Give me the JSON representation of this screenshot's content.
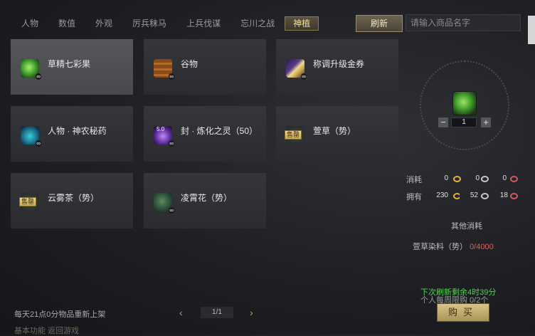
{
  "tabs": [
    {
      "label": "人物",
      "active": false
    },
    {
      "label": "数值",
      "active": false
    },
    {
      "label": "外观",
      "active": false
    },
    {
      "label": "厉兵秣马",
      "active": false
    },
    {
      "label": "上兵伐谋",
      "active": false
    },
    {
      "label": "忘川之战",
      "active": false
    },
    {
      "label": "神植",
      "active": true
    }
  ],
  "toolbar": {
    "refresh_label": "刷新",
    "search_placeholder": "请输入商品名字"
  },
  "items": [
    {
      "name": "草精七彩果",
      "icon": "fruit-icon",
      "selected": true
    },
    {
      "name": "谷物",
      "icon": "grain-barrel-icon",
      "selected": false
    },
    {
      "name": "称调升级金券",
      "icon": "gold-ticket-icon",
      "selected": false
    },
    {
      "name": "人物 · 神农秘药",
      "icon": "potion-icon",
      "selected": false
    },
    {
      "name": "封 · 炼化之灵（50）",
      "icon": "spirit-orb-icon",
      "icon_text": "5.0",
      "selected": false
    },
    {
      "name": "萱草（势）",
      "icon": "herb-icon",
      "badge": "售罄",
      "selected": false
    },
    {
      "name": "云雾茶（势）",
      "icon": "tea-icon",
      "badge": "售罄",
      "selected": false
    },
    {
      "name": "凌霄花（势）",
      "icon": "flower-icon",
      "selected": false
    }
  ],
  "infinite_mark": "∞",
  "detail": {
    "quantity": "1",
    "minus_label": "−",
    "plus_label": "+",
    "consume_label": "消耗",
    "own_label": "拥有",
    "consume": [
      "0",
      "0",
      "0"
    ],
    "own": [
      "230",
      "52",
      "18"
    ],
    "other_cost_label": "其他消耗",
    "cost_item": "萱草染料（势）",
    "cost_value": "0/4000",
    "refresh_countdown": "下次刷新剩余4时39分",
    "weekly_limit": "个人每周限购  0/2个",
    "buy_label": "购买"
  },
  "footer": {
    "daily_note": "每天21点0分物品重新上架",
    "page": "1/1",
    "prev": "‹",
    "next": "›",
    "cut_text": "基本功能  返回游戏"
  },
  "colors": {
    "accent_gold": "#e3b63a",
    "currency_silver": "#c8c8c8",
    "currency_red": "#d65a5a",
    "refresh_green": "#4fd44f",
    "cost_red": "#e06060"
  }
}
